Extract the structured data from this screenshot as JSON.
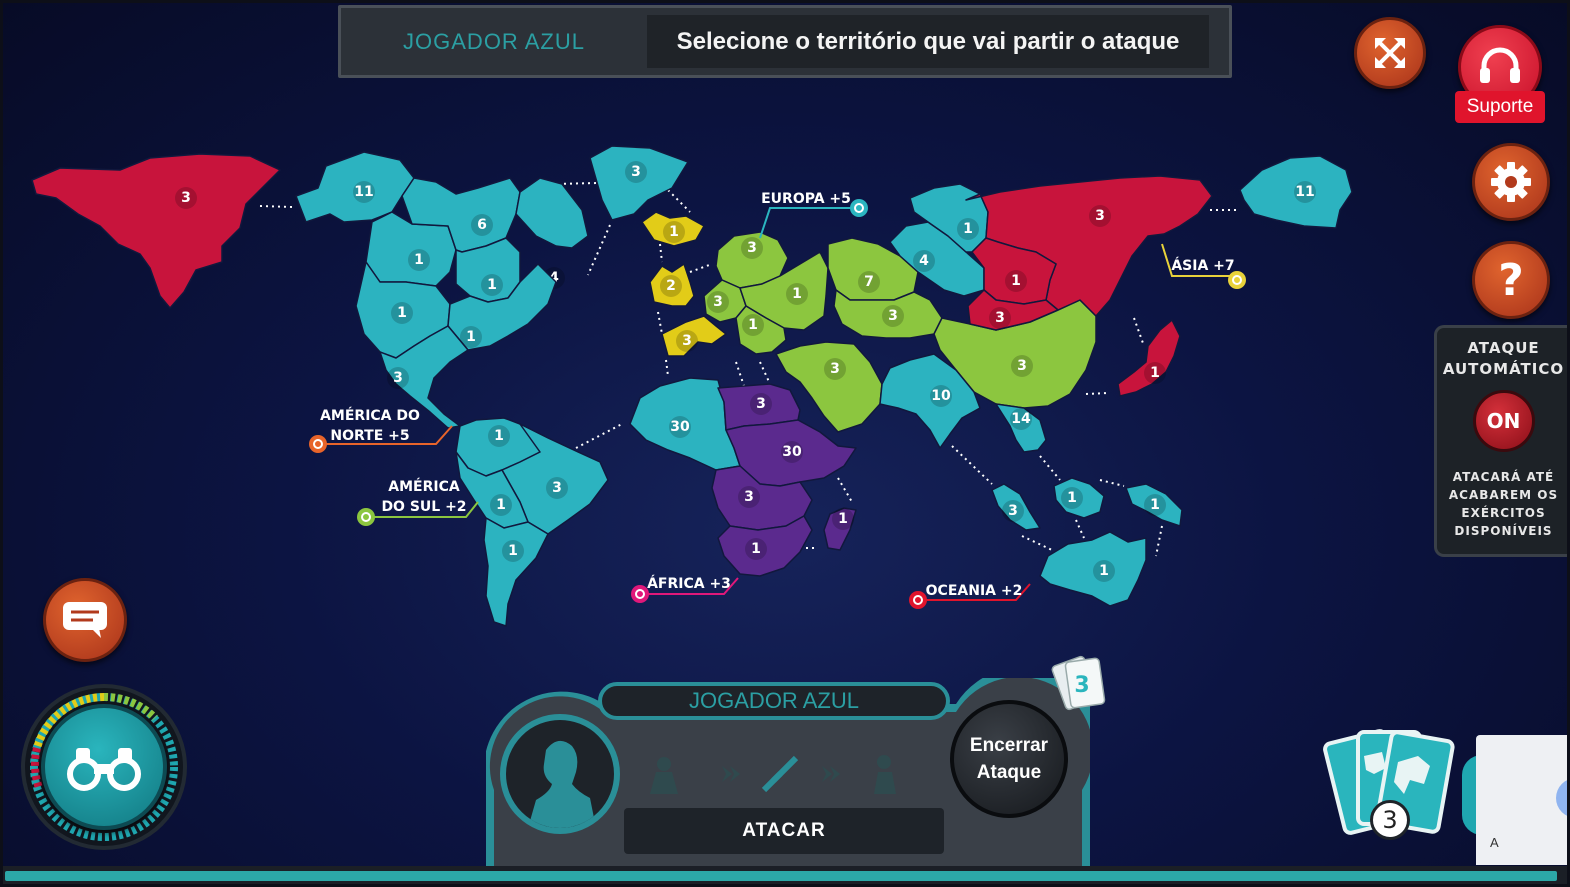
{
  "header": {
    "player_name": "JOGADOR AZUL",
    "instruction": "Selecione o território que vai partir o ataque"
  },
  "buttons": {
    "support_label": "Suporte",
    "help_icon": "?"
  },
  "auto_attack": {
    "title_line1": "ATAQUE",
    "title_line2": "AUTOMÁTICO",
    "state": "ON",
    "desc_line1": "ATACARÁ ATÉ",
    "desc_line2": "ACABAREM OS",
    "desc_line3": "EXÉRCITOS",
    "desc_line4": "DISPONÍVEIS"
  },
  "continents": [
    {
      "line1": "AMÉRICA DO",
      "line2": "NORTE +5",
      "color": "#e8642a"
    },
    {
      "line1": "AMÉRICA",
      "line2": "DO SUL +2",
      "color": "#8cc63f"
    },
    {
      "line1": "EUROPA +5",
      "line2": "",
      "color": "#2bb5c0"
    },
    {
      "line1": "ÁSIA +7",
      "line2": "",
      "color": "#e8d23a"
    },
    {
      "line1": "ÁFRICA +3",
      "line2": "",
      "color": "#e0187a"
    },
    {
      "line1": "OCEANIA +2",
      "line2": "",
      "color": "#e0142c"
    }
  ],
  "player_colors": {
    "blue": "#2cb3c0",
    "red": "#c8143c",
    "green": "#8cc63f",
    "yellow": "#e2cc18",
    "purple": "#5b2a8e"
  },
  "territories": [
    {
      "id": "alaska",
      "owner": "red",
      "armies": "3"
    },
    {
      "id": "mackenzie",
      "owner": "blue",
      "armies": "11"
    },
    {
      "id": "greenland",
      "owner": "blue",
      "armies": "3"
    },
    {
      "id": "vancouver",
      "owner": "blue",
      "armies": "1"
    },
    {
      "id": "ottawa",
      "owner": "blue",
      "armies": "6"
    },
    {
      "id": "labrador",
      "owner": "blue",
      "armies": "4"
    },
    {
      "id": "ontario",
      "owner": "blue",
      "armies": "1"
    },
    {
      "id": "california",
      "owner": "blue",
      "armies": "1"
    },
    {
      "id": "new-york",
      "owner": "blue",
      "armies": "1"
    },
    {
      "id": "mexico",
      "owner": "blue",
      "armies": "3"
    },
    {
      "id": "colombia",
      "owner": "blue",
      "armies": "1"
    },
    {
      "id": "brazil",
      "owner": "blue",
      "armies": "3"
    },
    {
      "id": "peru",
      "owner": "blue",
      "armies": "1"
    },
    {
      "id": "argentina",
      "owner": "blue",
      "armies": "1"
    },
    {
      "id": "iceland",
      "owner": "yellow",
      "armies": "1"
    },
    {
      "id": "england",
      "owner": "yellow",
      "armies": "2"
    },
    {
      "id": "portugal",
      "owner": "yellow",
      "armies": "3"
    },
    {
      "id": "sweden",
      "owner": "green",
      "armies": "3"
    },
    {
      "id": "germany",
      "owner": "green",
      "armies": "3"
    },
    {
      "id": "poland",
      "owner": "green",
      "armies": "1"
    },
    {
      "id": "italy",
      "owner": "green",
      "armies": "1"
    },
    {
      "id": "moscow",
      "owner": "green",
      "armies": "7"
    },
    {
      "id": "aral",
      "owner": "green",
      "armies": "3"
    },
    {
      "id": "middle-east",
      "owner": "green",
      "armies": "3"
    },
    {
      "id": "china",
      "owner": "green",
      "armies": "3"
    },
    {
      "id": "omsk",
      "owner": "blue",
      "armies": "4"
    },
    {
      "id": "dudinka",
      "owner": "blue",
      "armies": "1"
    },
    {
      "id": "siberia",
      "owner": "red",
      "armies": "3"
    },
    {
      "id": "tchita",
      "owner": "red",
      "armies": "1"
    },
    {
      "id": "mongolia",
      "owner": "red",
      "armies": "3"
    },
    {
      "id": "japan",
      "owner": "red",
      "armies": "1"
    },
    {
      "id": "vladivostok",
      "owner": "blue",
      "armies": "11"
    },
    {
      "id": "india",
      "owner": "blue",
      "armies": "10"
    },
    {
      "id": "vietnam",
      "owner": "blue",
      "armies": "14"
    },
    {
      "id": "algeria",
      "owner": "blue",
      "armies": "30"
    },
    {
      "id": "egypt",
      "owner": "purple",
      "armies": "3"
    },
    {
      "id": "sudan",
      "owner": "purple",
      "armies": "30"
    },
    {
      "id": "congo",
      "owner": "purple",
      "armies": "3"
    },
    {
      "id": "south-africa",
      "owner": "purple",
      "armies": "1"
    },
    {
      "id": "madagascar",
      "owner": "purple",
      "armies": "1"
    },
    {
      "id": "sumatra",
      "owner": "blue",
      "armies": "3"
    },
    {
      "id": "borneo",
      "owner": "blue",
      "armies": "1"
    },
    {
      "id": "new-guinea",
      "owner": "blue",
      "armies": "1"
    },
    {
      "id": "australia",
      "owner": "blue",
      "armies": "1"
    }
  ],
  "bottom": {
    "player_name": "JOGADOR AZUL",
    "attack_label": "ATACAR",
    "end_attack_line1": "Encerrar",
    "end_attack_line2": "Ataque",
    "cards_mini_count": "3",
    "cards_count": "3"
  },
  "corner_label": "A",
  "progress_fraction": 0.995
}
